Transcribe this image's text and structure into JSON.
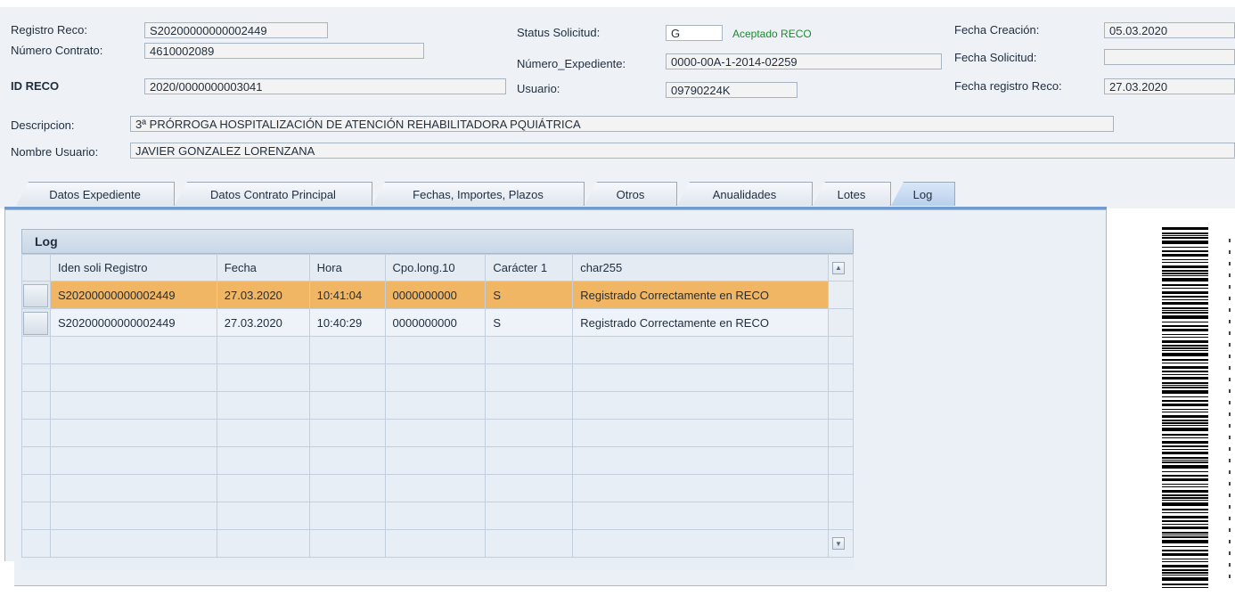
{
  "header": {
    "registro_reco": {
      "label": "Registro Reco:",
      "value": "S20200000000002449"
    },
    "numero_contrato": {
      "label": "Número Contrato:",
      "value": "4610002089"
    },
    "id_reco": {
      "label": "ID RECO",
      "value": "2020/0000000003041"
    },
    "status_solicitud": {
      "label": "Status Solicitud:",
      "value": "G",
      "text": "Aceptado RECO"
    },
    "numero_expediente": {
      "label": "Número_Expediente:",
      "value": "0000-00A-1-2014-02259"
    },
    "usuario": {
      "label": "Usuario:",
      "value": "09790224K"
    },
    "fecha_creacion": {
      "label": "Fecha Creación:",
      "value": "05.03.2020"
    },
    "fecha_solicitud": {
      "label": "Fecha Solicitud:",
      "value": ""
    },
    "fecha_registro_reco": {
      "label": "Fecha registro Reco:",
      "value": "27.03.2020"
    },
    "descripcion": {
      "label": "Descripcion:",
      "value": "3ª PRÓRROGA HOSPITALIZACIÓN DE ATENCIÓN REHABILITADORA PQUIÁTRICA"
    },
    "nombre_usuario": {
      "label": "Nombre Usuario:",
      "value": "JAVIER GONZALEZ LORENZANA"
    }
  },
  "tabs": [
    {
      "label": "Datos Expediente"
    },
    {
      "label": "Datos Contrato Principal"
    },
    {
      "label": "Fechas, Importes, Plazos"
    },
    {
      "label": "Otros"
    },
    {
      "label": "Anualidades"
    },
    {
      "label": "Lotes"
    },
    {
      "label": "Log"
    }
  ],
  "active_tab": "Log",
  "log": {
    "title": "Log",
    "columns": [
      "Iden soli Registro",
      "Fecha",
      "Hora",
      "Cpo.long.10",
      "Carácter 1",
      "char255"
    ],
    "rows": [
      [
        "S20200000000002449",
        "27.03.2020",
        "10:41:04",
        "0000000000",
        "S",
        "Registrado Correctamente en RECO"
      ],
      [
        "S20200000000002449",
        "27.03.2020",
        "10:40:29",
        "0000000000",
        "S",
        "Registrado Correctamente en RECO"
      ]
    ]
  },
  "colors": {
    "selected_row": "#f0b664",
    "status_accepted": "#1a8a2e",
    "tab_active": "#b8d0ec"
  }
}
